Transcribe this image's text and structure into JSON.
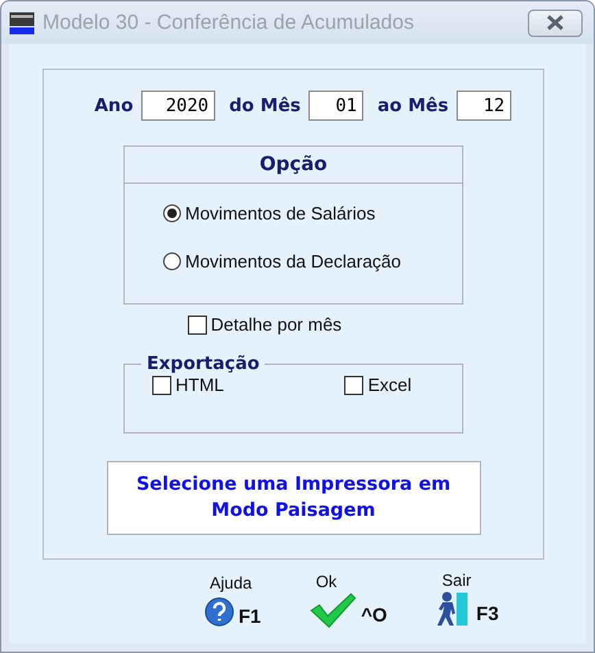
{
  "window": {
    "title": "Modelo 30 - Conferência de Acumulados"
  },
  "period": [
    {
      "label": "Ano",
      "value": "2020",
      "kind": "year"
    },
    {
      "label": "do Mês",
      "value": "01",
      "kind": "month"
    },
    {
      "label": "ao Mês",
      "value": "12",
      "kind": "month"
    }
  ],
  "option": {
    "title": "Opção",
    "items": [
      {
        "label": "Movimentos de Salários",
        "selected": true
      },
      {
        "label": "Movimentos da Declaração",
        "selected": false
      }
    ]
  },
  "detail": {
    "label": "Detalhe por mês",
    "checked": false
  },
  "export": {
    "title": "Exportação",
    "items": [
      {
        "label": "HTML",
        "checked": false
      },
      {
        "label": "Excel",
        "checked": false
      }
    ]
  },
  "message": "Selecione uma Impressora em Modo Paisagem",
  "buttons": [
    {
      "kind": "help",
      "label": "Ajuda",
      "key": "F1"
    },
    {
      "kind": "ok",
      "label": "Ok",
      "key": "^O"
    },
    {
      "kind": "exit",
      "label": "Sair",
      "key": "F3"
    }
  ]
}
